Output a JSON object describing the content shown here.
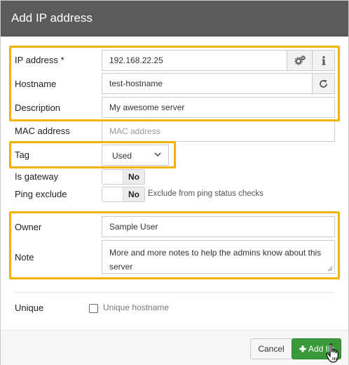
{
  "modal": {
    "title": "Add IP address"
  },
  "fields": {
    "ip_address": {
      "label": "IP address *",
      "value": "192.168.22.25"
    },
    "hostname": {
      "label": "Hostname",
      "value": "test-hostname"
    },
    "description": {
      "label": "Description",
      "value": "My awesome server"
    },
    "mac_address": {
      "label": "MAC address",
      "placeholder": "MAC address"
    },
    "tag": {
      "label": "Tag",
      "value": "Used"
    },
    "is_gateway": {
      "label": "Is gateway",
      "value": "No"
    },
    "ping_exclude": {
      "label": "Ping exclude",
      "value": "No",
      "hint": "Exclude from ping status checks"
    },
    "owner": {
      "label": "Owner",
      "value": "Sample User"
    },
    "note": {
      "label": "Note",
      "value": "More and more notes to help the admins know about this server"
    },
    "unique": {
      "label": "Unique",
      "checkbox_label": "Unique hostname",
      "checked": false
    }
  },
  "buttons": {
    "cancel": "Cancel",
    "add": "Add IP"
  },
  "icons": {
    "ip_addon_1": "gears-icon",
    "ip_addon_2": "info-icon",
    "hostname_addon": "refresh-icon",
    "tag_chevron": "chevron-down-icon",
    "add_button": "plus-icon",
    "cursor": "hand-pointer-icon"
  },
  "colors": {
    "header_bg": "#5b5b5b",
    "highlight": "#f0b400",
    "add_button": "#3a9a3a"
  }
}
